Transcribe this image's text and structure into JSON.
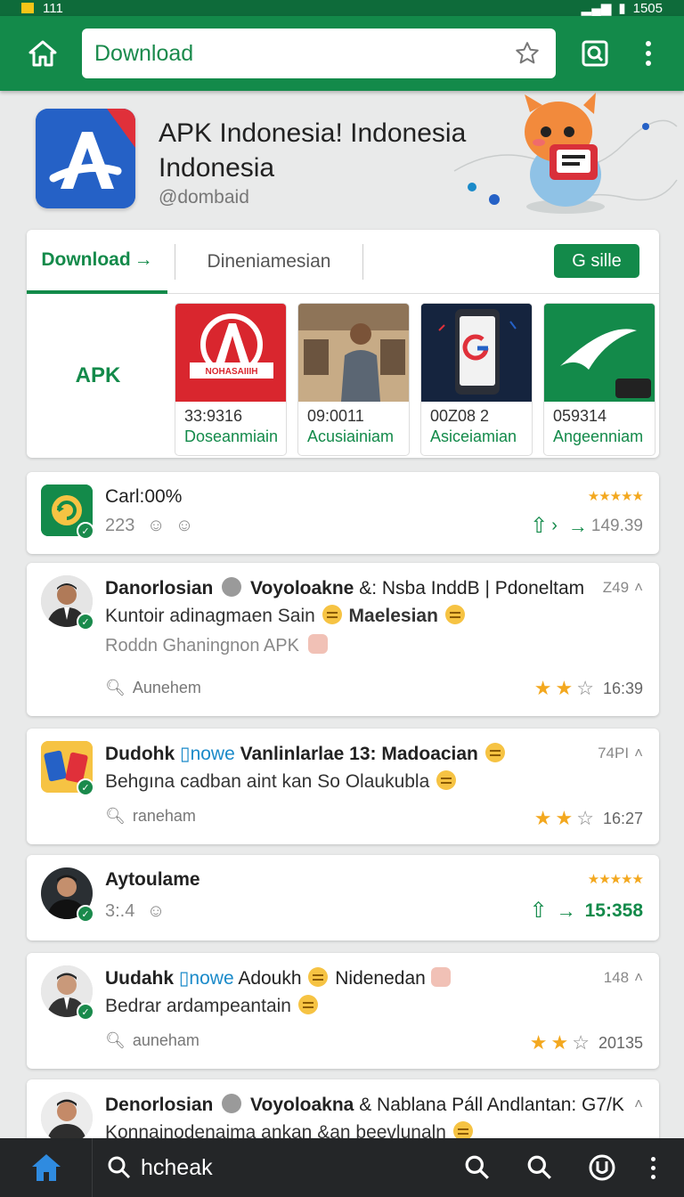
{
  "status_bar": {
    "left": "111",
    "right": "1505"
  },
  "toolbar": {
    "search_value": "Download"
  },
  "app": {
    "title": "APK Indonesia! Indonesia Indonesia",
    "developer": "@dombaid"
  },
  "tabs": {
    "download": "Download",
    "second": "Dineniamesian",
    "action_button": "G sille",
    "apk_label": "APK"
  },
  "tiles": [
    {
      "num": "33:9316",
      "label": "Doseanmiain",
      "thumb_text": "NOHASAIIIH"
    },
    {
      "num": "09:0011",
      "label": "Acusiainiam"
    },
    {
      "num": "00Z08 2",
      "label": "Asiceiamian"
    },
    {
      "num": "059314",
      "label": "Angeenniam"
    }
  ],
  "items": [
    {
      "title": "Carl:00%",
      "sub": "223",
      "value": "149.39"
    },
    {
      "title_bold_a": "Danorlosian",
      "title_bold_b": "Voyoloakne",
      "title_rest": "&: Nsba InddB | Pdoneltam",
      "time": "Z49",
      "line2_a": "Kuntoir adinagmaen Sain",
      "line2_b": "Maelesian",
      "line3": "Roddn Ghaningnon APK",
      "search": "Aunehem",
      "rating_text": "16:39"
    },
    {
      "title_bold_a": "Dudohk",
      "chip": "nowe",
      "title_bold_b": "Vanlinlarlae 13: Madoacian",
      "time": "74PI",
      "line2": "Behgına cadban aint kan So Olaukubla",
      "search": "raneham",
      "rating_text": "16:27"
    },
    {
      "title": "Aytoulame",
      "sub": "3:.4",
      "value": "15:358"
    },
    {
      "title_bold_a": "Uudahk",
      "chip": "nowe",
      "title_rest_a": "Adoukh",
      "title_rest_b": "Nidenedan",
      "time": "148",
      "line2": "Bedrar ardampeantain",
      "search": "auneham",
      "rating_text": "20135"
    },
    {
      "title_bold_a": "Denorlosian",
      "title_bold_b": "Voyoloakna",
      "title_rest": "& Nablana Páll Andlantan: G7/K",
      "line2": "Konnainodenaima ankan &an beevlunaln"
    }
  ],
  "bottom_bar": {
    "search_text": "hcheak"
  },
  "colors": {
    "primary": "#138a4a",
    "star": "#f3a81f",
    "icon_blue": "#2561c6",
    "icon_red": "#e0303a"
  }
}
